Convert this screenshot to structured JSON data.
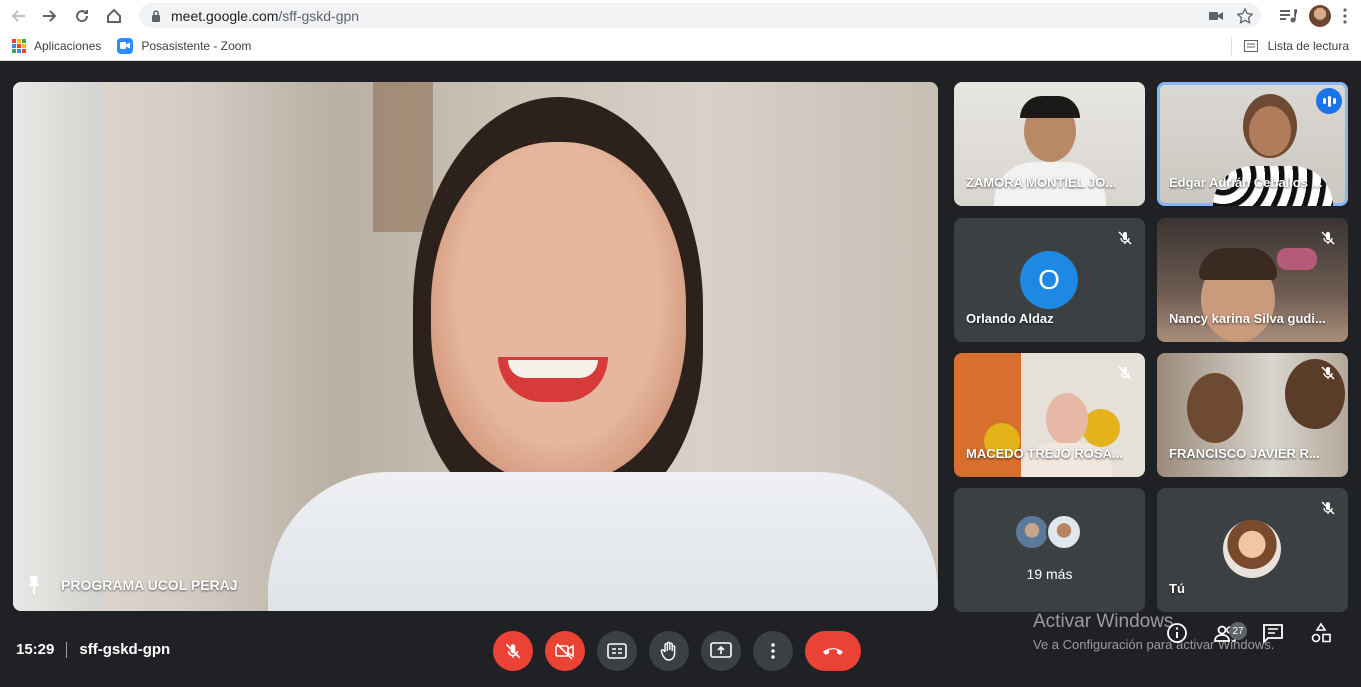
{
  "browser": {
    "url_host": "meet.google.com",
    "url_path": "/sff-gskd-gpn",
    "bookmarks": [
      {
        "label": "Aplicaciones",
        "icon": "apps-grid-icon"
      },
      {
        "label": "Posasistente - Zoom",
        "icon": "zoom-icon"
      }
    ],
    "reading_list": "Lista de lectura"
  },
  "main_participant": {
    "name": "PROGRAMA UCOL PERAJ",
    "icon": "pin-icon"
  },
  "tiles": [
    {
      "name": "ZAMORA MONTIEL JO...",
      "mic": "on",
      "speaking": false,
      "active": false
    },
    {
      "name": "Edgar Adrián Ceballos ...",
      "mic": "on",
      "speaking": true,
      "active": true
    },
    {
      "name": "Orlando Aldaz",
      "mic": "off",
      "speaking": false,
      "avatar_letter": "O"
    },
    {
      "name": "Nancy karina Silva gudi...",
      "mic": "off",
      "speaking": false
    },
    {
      "name": "MACEDO TREJO ROSA...",
      "mic": "off",
      "speaking": false
    },
    {
      "name": "FRANCISCO JAVIER R...",
      "mic": "off",
      "speaking": false
    },
    {
      "more_label": "19 más"
    },
    {
      "name": "Tú",
      "mic": "off"
    }
  ],
  "meeting": {
    "time": "15:29",
    "code": "sff-gskd-gpn",
    "participants_count": "27"
  },
  "controls": {
    "mic": "mic-off-icon",
    "camera": "camera-off-icon",
    "captions": "captions-icon",
    "hand": "raise-hand-icon",
    "present": "present-screen-icon",
    "more": "more-vert-icon",
    "hangup": "hangup-icon"
  },
  "watermark": {
    "line1": "Activar Windows",
    "line2": "Ve a Configuración para activar Windows."
  },
  "colors": {
    "bg": "#202124",
    "tile": "#3c4043",
    "red": "#ea4335",
    "blue": "#1a73e8"
  }
}
